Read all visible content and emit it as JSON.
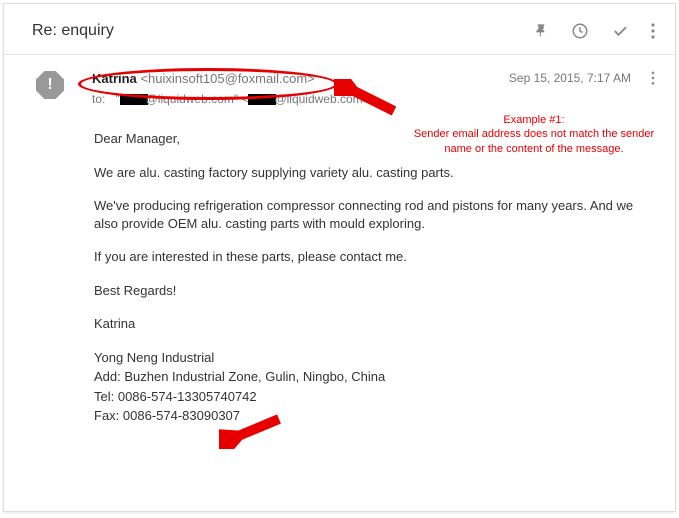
{
  "header": {
    "subject": "Re: enquiry"
  },
  "sender": {
    "name": "Katrina",
    "email": "<huixinsoft105@foxmail.com>",
    "timestamp": "Sep 15, 2015, 7:17 AM"
  },
  "recipients": {
    "to_label": "to:",
    "domain1": "@liquidweb.com\"",
    "domain2": "@liquidweb.com>"
  },
  "body": {
    "greeting": "Dear Manager,",
    "p1": "We are alu. casting factory supplying variety alu. casting parts.",
    "p2": "We've producing refrigeration compressor connecting rod and pistons for many years. And we also provide OEM alu. casting parts with mould exploring.",
    "p3": "If you are interested in these parts, please contact me.",
    "p4": "Best Regards!",
    "p5": "Katrina",
    "company": "Yong Neng Industrial",
    "addr": "Add: Buzhen Industrial Zone, Gulin, Ningbo, China",
    "tel": "Tel: 0086-574-13305740742",
    "fax": "Fax: 0086-574-83090307"
  },
  "annotation": {
    "title": "Example #1:",
    "text": "Sender email address does not match the sender name or the content of the message."
  }
}
